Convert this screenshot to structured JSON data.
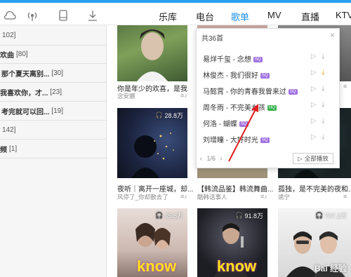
{
  "nav": {
    "tabs": [
      {
        "label": "乐库"
      },
      {
        "label": "电台"
      },
      {
        "label": "歌单"
      },
      {
        "label": "MV"
      },
      {
        "label": "直播"
      },
      {
        "label": "KTV"
      }
    ]
  },
  "sidebar": {
    "items": [
      {
        "title": "",
        "count": "102]"
      },
      {
        "title": "欢曲",
        "count": "[80]"
      },
      {
        "title": "那个夏天离别...",
        "count": "[30]"
      },
      {
        "title": "我喜欢你，才...",
        "count": "[23]"
      },
      {
        "title": "考完就可以回...",
        "count": "[19]"
      },
      {
        "title": "",
        "count": "142]"
      },
      {
        "title": "频",
        "count": "[1]"
      }
    ]
  },
  "cards": [
    {
      "title": "你是年少的欢喜，是我",
      "sub": "念安娜",
      "plays": ""
    },
    {
      "title": "",
      "sub": "",
      "plays": ""
    },
    {
      "title": "",
      "sub": "",
      "plays": ""
    },
    {
      "title": "夜听｜离开一座城，却...",
      "sub": "风停了_你却散去了",
      "plays": "28.8万"
    },
    {
      "title": "【韩流品鉴】韩流舞曲...",
      "sub": "酷韩话事人",
      "plays": ""
    },
    {
      "title": "孤独，是不完美的夜和...",
      "sub": "诱宁",
      "plays": ""
    },
    {
      "title": "",
      "sub": "",
      "plays": "45.8万"
    },
    {
      "title": "",
      "sub": "",
      "plays": "91.8万"
    },
    {
      "title": "",
      "sub": "",
      "plays": "707.2万"
    }
  ],
  "popup": {
    "header": "共36首",
    "songs": [
      {
        "name": "易烊千玺 - 念想",
        "badge": "SQ"
      },
      {
        "name": "林俊杰 - 我们很好",
        "badge": "SQ"
      },
      {
        "name": "马懿霄 - 你的青春我曾来过",
        "badge": "SQ"
      },
      {
        "name": "周冬雨 - 不完美女孩",
        "badge": "HQ"
      },
      {
        "name": "何洛 - 蝴蝶",
        "badge": "SQ"
      },
      {
        "name": "刘增瞳 - 大好时光",
        "badge": "SQ"
      }
    ],
    "pager": "1/6",
    "play_all": "全部播放"
  },
  "overlay_text": {
    "know1": "know",
    "know2": "know"
  },
  "watermark": "Bai 经验"
}
